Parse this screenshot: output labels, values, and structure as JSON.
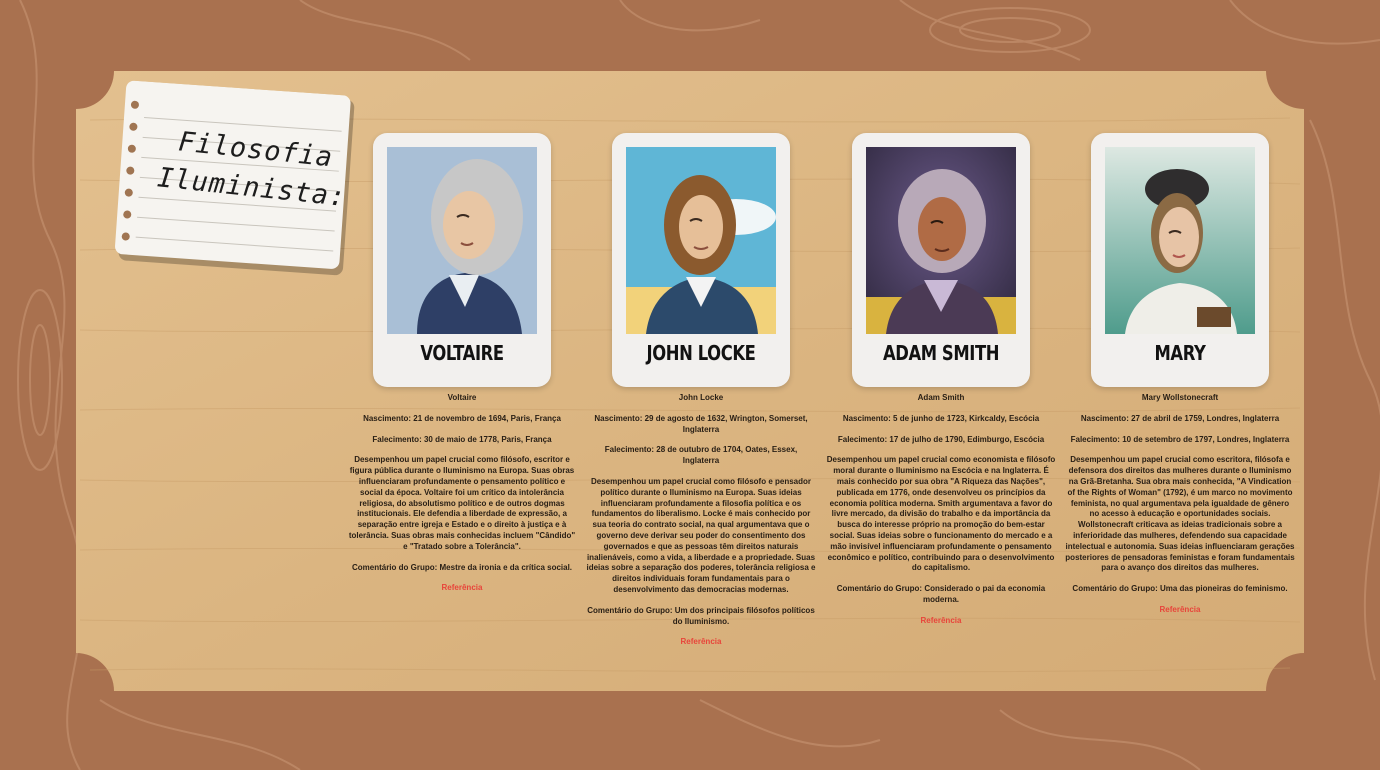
{
  "title": "Filosofia Iluminista:",
  "colors": {
    "wood_dark": "#a9714f",
    "board": "#dcb583",
    "card": "#f2f0ee",
    "reference": "#e8443a"
  },
  "philosophers": [
    {
      "card_name": "VOLTAIRE",
      "full_name": "Voltaire",
      "birth": "Nascimento: 21 de novembro de 1694, Paris, França",
      "death": "Falecimento: 30 de maio de 1778, Paris, França",
      "bio": "Desempenhou um papel crucial como filósofo, escritor e figura pública durante o Iluminismo na Europa. Suas obras influenciaram profundamente o pensamento político e social da época. Voltaire foi um crítico da intolerância religiosa, do absolutismo político e de outros dogmas institucionais. Ele defendia a liberdade de expressão, a separação entre igreja e Estado e o direito à justiça e à tolerância. Suas obras mais conhecidas incluem \"Cândido\" e \"Tratado sobre a Tolerância\".",
      "comment": "Comentário do Grupo: Mestre da ironia e da crítica social.",
      "reference": "Referência"
    },
    {
      "card_name": "JOHN LOCKE",
      "full_name": "John Locke",
      "birth": "Nascimento: 29 de agosto de 1632, Wrington, Somerset, Inglaterra",
      "death": "Falecimento: 28 de outubro de 1704, Oates, Essex, Inglaterra",
      "bio": "Desempenhou um papel crucial como filósofo e pensador político durante o Iluminismo na Europa. Suas ideias influenciaram profundamente a filosofia política e os fundamentos do liberalismo. Locke é mais conhecido por sua teoria do contrato social, na qual argumentava que o governo deve derivar seu poder do consentimento dos governados e que as pessoas têm direitos naturais inalienáveis, como a vida, a liberdade e a propriedade. Suas ideias sobre a separação dos poderes, tolerância religiosa e direitos individuais foram fundamentais para o desenvolvimento das democracias modernas.",
      "comment": "Comentário do Grupo: Um dos principais filósofos políticos do Iluminismo.",
      "reference": "Referência"
    },
    {
      "card_name": "ADAM SMITH",
      "full_name": "Adam Smith",
      "birth": "Nascimento: 5 de junho de 1723, Kirkcaldy, Escócia",
      "death": "Falecimento: 17 de julho de 1790, Edimburgo, Escócia",
      "bio": "Desempenhou um papel crucial como economista e filósofo moral durante o Iluminismo na Escócia e na Inglaterra. É mais conhecido por sua obra \"A Riqueza das Nações\", publicada em 1776, onde desenvolveu os princípios da economia política moderna. Smith argumentava a favor do livre mercado, da divisão do trabalho e da importância da busca do interesse próprio na promoção do bem-estar social. Suas ideias sobre o funcionamento do mercado e a mão invisível influenciaram profundamente o pensamento econômico e político, contribuindo para o desenvolvimento do capitalismo.",
      "comment": "Comentário do Grupo: Considerado o pai da economia moderna.",
      "reference": "Referência"
    },
    {
      "card_name": "MARY",
      "full_name": "Mary Wollstonecraft",
      "birth": "Nascimento: 27 de abril de 1759, Londres, Inglaterra",
      "death": "Falecimento: 10 de setembro de 1797, Londres, Inglaterra",
      "bio": "Desempenhou um papel crucial como escritora, filósofa e defensora dos direitos das mulheres durante o Iluminismo na Grã-Bretanha. Sua obra mais conhecida, \"A Vindication of the Rights of Woman\" (1792), é um marco no movimento feminista, no qual argumentava pela igualdade de gênero no acesso à educação e oportunidades sociais. Wollstonecraft criticava as ideias tradicionais sobre a inferioridade das mulheres, defendendo sua capacidade intelectual e autonomia. Suas ideias influenciaram gerações posteriores de pensadoras feministas e foram fundamentais para o avanço dos direitos das mulheres.",
      "comment": "Comentário do Grupo: Uma das pioneiras do feminismo.",
      "reference": "Referência"
    }
  ]
}
